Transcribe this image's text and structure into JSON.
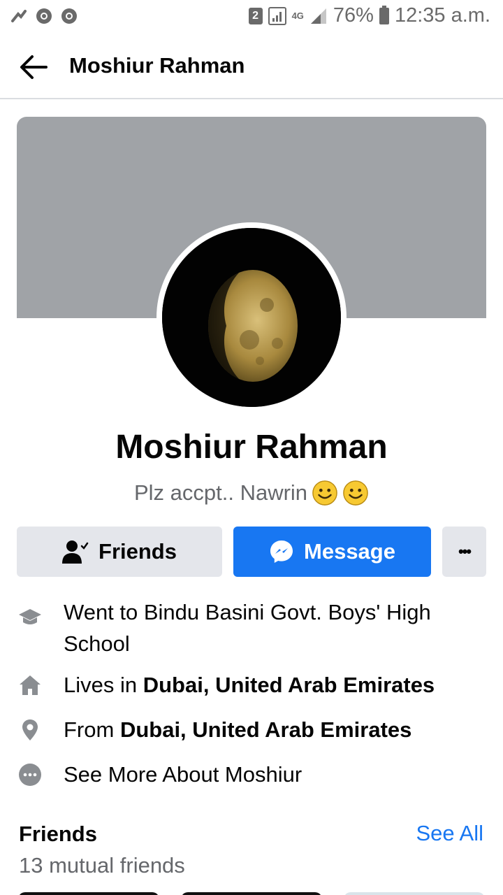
{
  "status_bar": {
    "sim_slot": "2",
    "network_type": "4G",
    "battery": "76%",
    "time": "12:35 a.m.",
    "left_icons": [
      "phone-call-icon",
      "chrome-icon",
      "chrome-icon"
    ]
  },
  "header": {
    "back_icon": "back-arrow-icon",
    "title": "Moshiur Rahman"
  },
  "profile": {
    "name": "Moshiur Rahman",
    "bio_text": "Plz accpt..  Nawrin",
    "bio_emojis": [
      "smiley",
      "smiley"
    ]
  },
  "actions": {
    "friends_label": "Friends",
    "message_label": "Message",
    "more_label": "•••"
  },
  "info": {
    "education": "Went to Bindu Basini Govt. Boys' High School",
    "lives_prefix": "Lives in ",
    "lives_place": "Dubai, United Arab Emirates",
    "from_prefix": "From ",
    "from_place": "Dubai, United Arab Emirates",
    "see_more": "See More About Moshiur"
  },
  "friends": {
    "title": "Friends",
    "see_all": "See All",
    "mutual": "13 mutual friends"
  },
  "colors": {
    "accent": "#1877f2",
    "cover": "#a0a3a7",
    "button_gray": "#e4e6eb",
    "secondary_text": "#65676b"
  }
}
